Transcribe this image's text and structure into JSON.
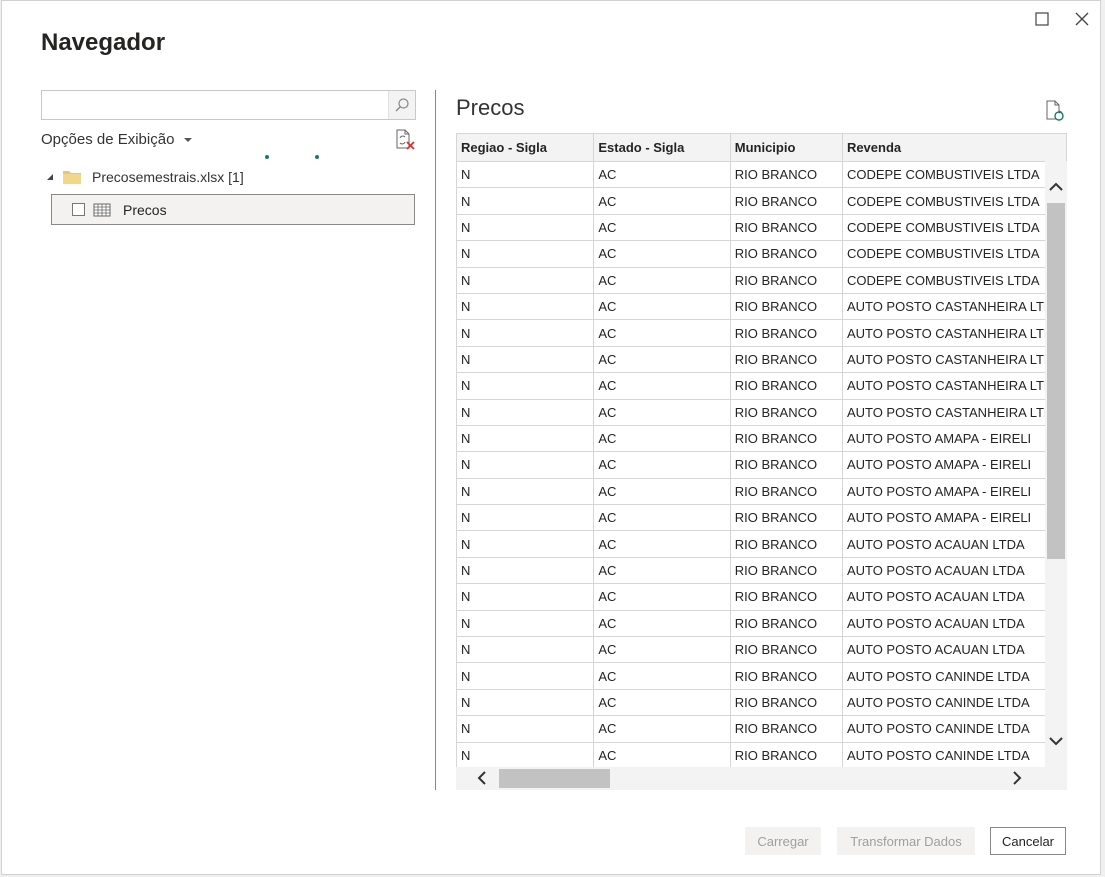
{
  "dialog": {
    "title": "Navegador"
  },
  "left_panel": {
    "search_placeholder": "",
    "view_options_label": "Opções de Exibição",
    "tree": {
      "file_label": "Precosemestrais.xlsx [1]",
      "items": [
        {
          "label": "Precos",
          "checked": false
        }
      ]
    }
  },
  "preview": {
    "title": "Precos",
    "columns": [
      "Regiao - Sigla",
      "Estado - Sigla",
      "Municipio",
      "Revenda"
    ],
    "rows": [
      [
        "N",
        "AC",
        "RIO BRANCO",
        "CODEPE COMBUSTIVEIS LTDA"
      ],
      [
        "N",
        "AC",
        "RIO BRANCO",
        "CODEPE COMBUSTIVEIS LTDA"
      ],
      [
        "N",
        "AC",
        "RIO BRANCO",
        "CODEPE COMBUSTIVEIS LTDA"
      ],
      [
        "N",
        "AC",
        "RIO BRANCO",
        "CODEPE COMBUSTIVEIS LTDA"
      ],
      [
        "N",
        "AC",
        "RIO BRANCO",
        "CODEPE COMBUSTIVEIS LTDA"
      ],
      [
        "N",
        "AC",
        "RIO BRANCO",
        "AUTO POSTO CASTANHEIRA LTDA"
      ],
      [
        "N",
        "AC",
        "RIO BRANCO",
        "AUTO POSTO CASTANHEIRA LTDA"
      ],
      [
        "N",
        "AC",
        "RIO BRANCO",
        "AUTO POSTO CASTANHEIRA LTDA"
      ],
      [
        "N",
        "AC",
        "RIO BRANCO",
        "AUTO POSTO CASTANHEIRA LTDA"
      ],
      [
        "N",
        "AC",
        "RIO BRANCO",
        "AUTO POSTO CASTANHEIRA LTDA"
      ],
      [
        "N",
        "AC",
        "RIO BRANCO",
        "AUTO POSTO AMAPA - EIRELI"
      ],
      [
        "N",
        "AC",
        "RIO BRANCO",
        "AUTO POSTO AMAPA - EIRELI"
      ],
      [
        "N",
        "AC",
        "RIO BRANCO",
        "AUTO POSTO AMAPA - EIRELI"
      ],
      [
        "N",
        "AC",
        "RIO BRANCO",
        "AUTO POSTO AMAPA - EIRELI"
      ],
      [
        "N",
        "AC",
        "RIO BRANCO",
        "AUTO POSTO ACAUAN LTDA"
      ],
      [
        "N",
        "AC",
        "RIO BRANCO",
        "AUTO POSTO ACAUAN LTDA"
      ],
      [
        "N",
        "AC",
        "RIO BRANCO",
        "AUTO POSTO ACAUAN LTDA"
      ],
      [
        "N",
        "AC",
        "RIO BRANCO",
        "AUTO POSTO ACAUAN LTDA"
      ],
      [
        "N",
        "AC",
        "RIO BRANCO",
        "AUTO POSTO ACAUAN LTDA"
      ],
      [
        "N",
        "AC",
        "RIO BRANCO",
        "AUTO POSTO CANINDE LTDA"
      ],
      [
        "N",
        "AC",
        "RIO BRANCO",
        "AUTO POSTO CANINDE LTDA"
      ],
      [
        "N",
        "AC",
        "RIO BRANCO",
        "AUTO POSTO CANINDE LTDA"
      ],
      [
        "N",
        "AC",
        "RIO BRANCO",
        "AUTO POSTO CANINDE LTDA"
      ]
    ]
  },
  "footer": {
    "load_label": "Carregar",
    "transform_label": "Transformar Dados",
    "cancel_label": "Cancelar"
  },
  "colors": {
    "accent": "#1a7a6a",
    "error_icon": "#d13438"
  }
}
